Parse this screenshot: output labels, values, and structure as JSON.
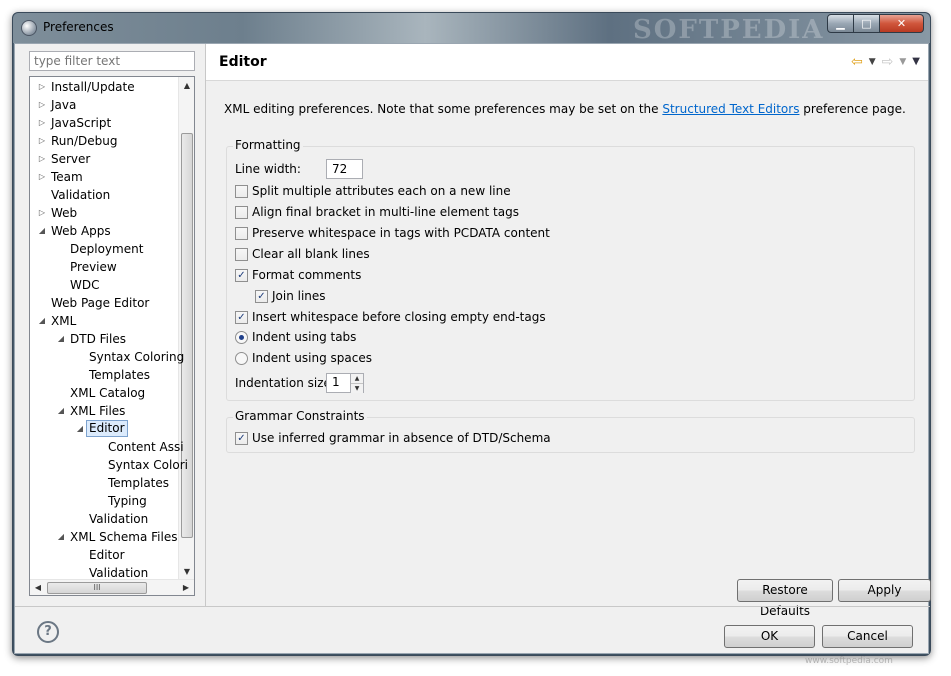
{
  "window": {
    "title": "Preferences",
    "watermark": "SOFTPEDIA",
    "minimize_icon": "minimize-icon",
    "maximize_icon": "maximize-icon",
    "close_icon": "close-icon",
    "minimize_glyph": "▁",
    "maximize_glyph": "□",
    "close_glyph": "✕"
  },
  "filter": {
    "placeholder": "type filter text"
  },
  "tree": {
    "items": [
      {
        "label": "Install/Update",
        "level": 0,
        "arrow": "collapsed"
      },
      {
        "label": "Java",
        "level": 0,
        "arrow": "collapsed"
      },
      {
        "label": "JavaScript",
        "level": 0,
        "arrow": "collapsed"
      },
      {
        "label": "Run/Debug",
        "level": 0,
        "arrow": "collapsed"
      },
      {
        "label": "Server",
        "level": 0,
        "arrow": "collapsed"
      },
      {
        "label": "Team",
        "level": 0,
        "arrow": "collapsed"
      },
      {
        "label": "Validation",
        "level": 0,
        "arrow": "none"
      },
      {
        "label": "Web",
        "level": 0,
        "arrow": "collapsed"
      },
      {
        "label": "Web Apps",
        "level": 0,
        "arrow": "expanded"
      },
      {
        "label": "Deployment",
        "level": 1,
        "arrow": "none"
      },
      {
        "label": "Preview",
        "level": 1,
        "arrow": "none"
      },
      {
        "label": "WDC",
        "level": 1,
        "arrow": "none"
      },
      {
        "label": "Web Page Editor",
        "level": 0,
        "arrow": "none"
      },
      {
        "label": "XML",
        "level": 0,
        "arrow": "expanded"
      },
      {
        "label": "DTD Files",
        "level": 1,
        "arrow": "expanded"
      },
      {
        "label": "Syntax Coloring",
        "level": 2,
        "arrow": "none"
      },
      {
        "label": "Templates",
        "level": 2,
        "arrow": "none"
      },
      {
        "label": "XML Catalog",
        "level": 1,
        "arrow": "none"
      },
      {
        "label": "XML Files",
        "level": 1,
        "arrow": "expanded"
      },
      {
        "label": "Editor",
        "level": 2,
        "arrow": "expanded",
        "selected": true
      },
      {
        "label": "Content Assi",
        "level": 3,
        "arrow": "none"
      },
      {
        "label": "Syntax Colori",
        "level": 3,
        "arrow": "none"
      },
      {
        "label": "Templates",
        "level": 3,
        "arrow": "none"
      },
      {
        "label": "Typing",
        "level": 3,
        "arrow": "none"
      },
      {
        "label": "Validation",
        "level": 2,
        "arrow": "none"
      },
      {
        "label": "XML Schema Files",
        "level": 1,
        "arrow": "expanded"
      },
      {
        "label": "Editor",
        "level": 2,
        "arrow": "none"
      },
      {
        "label": "Validation",
        "level": 2,
        "arrow": "none"
      }
    ],
    "arrow_glyphs": {
      "collapsed": "▷",
      "expanded": "◢",
      "none": ""
    }
  },
  "page": {
    "title": "Editor",
    "nav": {
      "back_icon": "back-arrow-icon",
      "forward_icon": "forward-arrow-icon",
      "menu_icon": "view-menu-icon"
    },
    "description_prefix": "XML editing preferences.  Note that some preferences may be set on the ",
    "description_link": "Structured Text Editors",
    "description_suffix": " preference page."
  },
  "formatting": {
    "label": "Formatting",
    "line_width_label": "Line width:",
    "line_width_value": "72",
    "options": [
      {
        "label": "Split multiple attributes each on a new line",
        "checked": false
      },
      {
        "label": "Align final bracket in multi-line element tags",
        "checked": false
      },
      {
        "label": "Preserve whitespace in tags with PCDATA content",
        "checked": false
      },
      {
        "label": "Clear all blank lines",
        "checked": false
      },
      {
        "label": "Format comments",
        "checked": true
      },
      {
        "label": "Join lines",
        "checked": true,
        "indent": true
      },
      {
        "label": "Insert whitespace before closing empty end-tags",
        "checked": true
      }
    ],
    "indent_tabs_label": "Indent using tabs",
    "indent_tabs_selected": true,
    "indent_spaces_label": "Indent using spaces",
    "indent_spaces_selected": false,
    "indentation_size_label": "Indentation size:",
    "indentation_size_value": "1"
  },
  "grammar": {
    "label": "Grammar Constraints",
    "use_inferred_label": "Use inferred grammar in absence of DTD/Schema",
    "use_inferred_checked": true
  },
  "buttons": {
    "restore_defaults": "Restore Defaults",
    "apply": "Apply",
    "ok": "OK",
    "cancel": "Cancel"
  },
  "footer": {
    "help_icon": "help-icon",
    "watermark_url": "www.softpedia.com"
  }
}
